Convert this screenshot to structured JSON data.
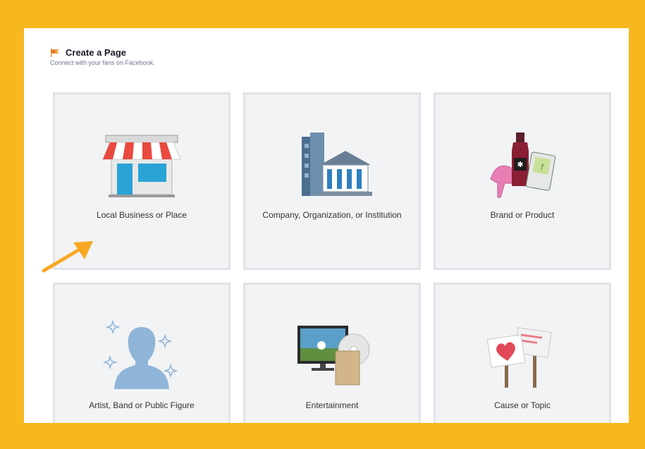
{
  "header": {
    "title": "Create a Page",
    "subtitle": "Connect with your fans on Facebook."
  },
  "categories": [
    {
      "label": "Local Business or Place",
      "icon": "storefront-icon"
    },
    {
      "label": "Company, Organization, or Institution",
      "icon": "building-icon"
    },
    {
      "label": "Brand or Product",
      "icon": "products-icon"
    },
    {
      "label": "Artist, Band or Public Figure",
      "icon": "person-silhouette-icon"
    },
    {
      "label": "Entertainment",
      "icon": "tv-media-icon"
    },
    {
      "label": "Cause or Topic",
      "icon": "signs-icon"
    }
  ],
  "colors": {
    "background_border": "#f7b81f",
    "tile_bg": "#f2f3f5",
    "tile_border": "#e1e3e8",
    "arrow": "#f7a823"
  }
}
